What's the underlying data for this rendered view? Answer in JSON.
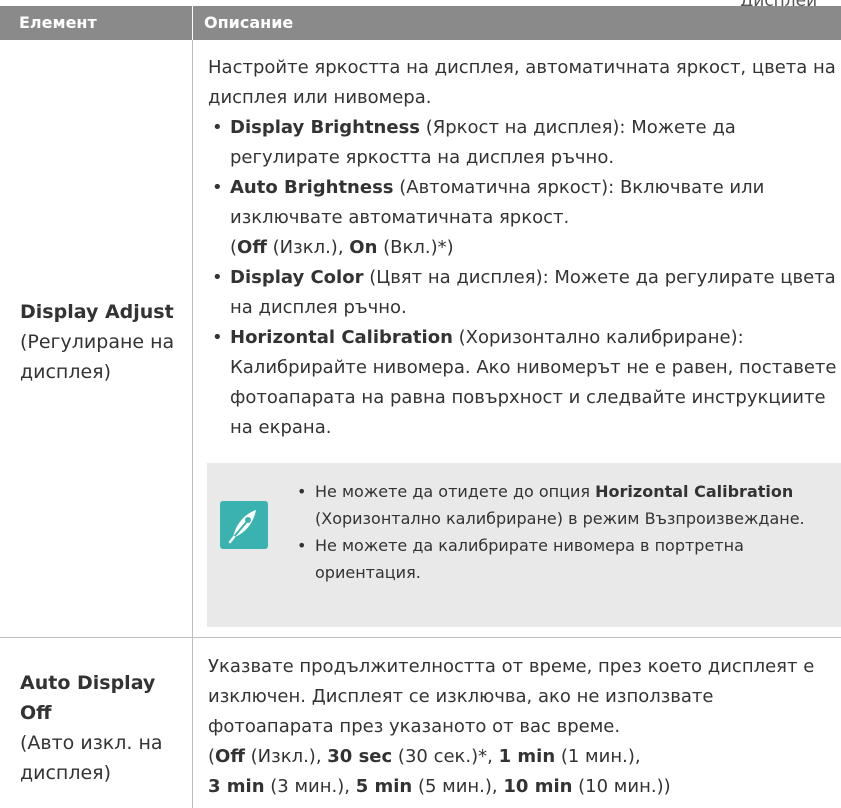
{
  "page_header_clip": "Дисплей",
  "table": {
    "header": {
      "col1": "Елемент",
      "col2": "Описание"
    },
    "rows": [
      {
        "name_bold": "Display Adjust",
        "name_sub": "(Регулиране на дисплея)",
        "intro": "Настройте яркостта на дисплея, автоматичната яркост, цвета на дисплея или нивомера.",
        "bullets": [
          {
            "bold": "Display Brightness",
            "text": " (Яркост на дисплея): Можете да регулирате яркостта на дисплея ръчно."
          },
          {
            "bold": "Auto Brightness",
            "text": " (Автоматична яркост): Включвате или изключвате автоматичната яркост.",
            "opt_open": "(",
            "opt1_bold": "Off",
            "opt1_text": " (Изкл.), ",
            "opt2_bold": "On",
            "opt2_text": " (Вкл.)*)"
          },
          {
            "bold": "Display Color",
            "text": " (Цвят на дисплея): Можете да регулирате цвета на дисплея ръчно."
          },
          {
            "bold": "Horizontal Calibration",
            "text": " (Хоризонтално калибриране): Калибрирайте нивомера. Ако нивомерът не е равен, поставете фотоапарата на равна повърхност и следвайте инструкциите на екрана."
          }
        ],
        "note": {
          "icon": "note-pen-icon",
          "items": [
            {
              "pre": "Не можете да отидете до опция ",
              "bold": "Horizontal Calibration",
              "post": " (Хоризонтално калибриране) в режим Възпроизвеждане."
            },
            {
              "text": "Не можете да калибрирате нивомера в портретна ориентация."
            }
          ]
        }
      },
      {
        "name_bold": "Auto Display Off",
        "name_sub": "(Авто изкл. на дисплея)",
        "desc": "Указвате продължителността от време, през което дисплеят е изключен. Дисплеят се изключва, ако не използвате фотоапарата през указаното от вас време.",
        "options": [
          {
            "bold": "Off",
            "text": " (Изкл.), "
          },
          {
            "bold": "30 sec",
            "text": " (30 сек.)*, "
          },
          {
            "bold": "1 min",
            "text": " (1 мин.), "
          },
          {
            "bold": "3 min",
            "text": " (3 мин.), "
          },
          {
            "bold": "5 min",
            "text": " (5 мин.), "
          },
          {
            "bold": "10 min",
            "text": " (10 мин.))"
          }
        ]
      }
    ]
  },
  "colors": {
    "header_bg": "#8a8a8a",
    "note_bg": "#e9e9e9",
    "icon_bg": "#3ab3b0",
    "text": "#333333"
  }
}
